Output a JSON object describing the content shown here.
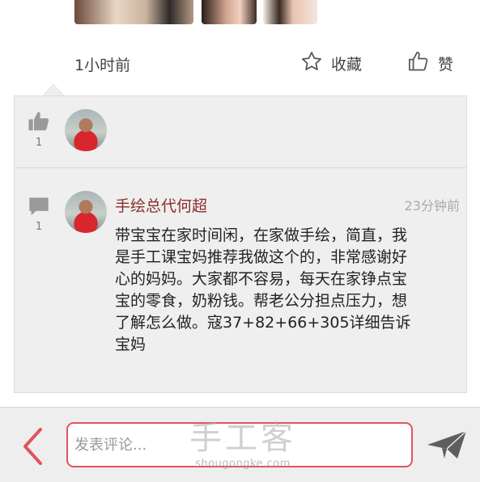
{
  "post_footer": {
    "time_ago": "1小时前",
    "favorite_label": "收藏",
    "like_label": "赞"
  },
  "likes_section": {
    "like_count": "1"
  },
  "comment": {
    "count": "1",
    "author": "手绘总代何超",
    "time": "23分钟前",
    "text": "带宝宝在家时间闲，在家做手绘，简直，我是手工课宝妈推荐我做这个的，非常感谢好心的妈妈。大家都不容易，每天在家铮点宝宝的零食，奶粉钱。帮老公分担点压力，想了解怎么做。寇37+82+66+305详细告诉宝妈"
  },
  "bottom_bar": {
    "input_placeholder": "发表评论..."
  },
  "watermark": {
    "main": "手工客",
    "sub": "shougongke.com"
  },
  "colors": {
    "accent_red": "#e2545b",
    "author_red": "#8a2d2a",
    "panel_bg": "#efefef",
    "icon_gray": "#9a9a9a"
  },
  "icons": [
    "star-outline-icon",
    "thumbs-up-outline-icon",
    "thumbs-up-icon",
    "comment-bubble-icon",
    "back-chevron-icon",
    "send-paper-plane-icon"
  ]
}
